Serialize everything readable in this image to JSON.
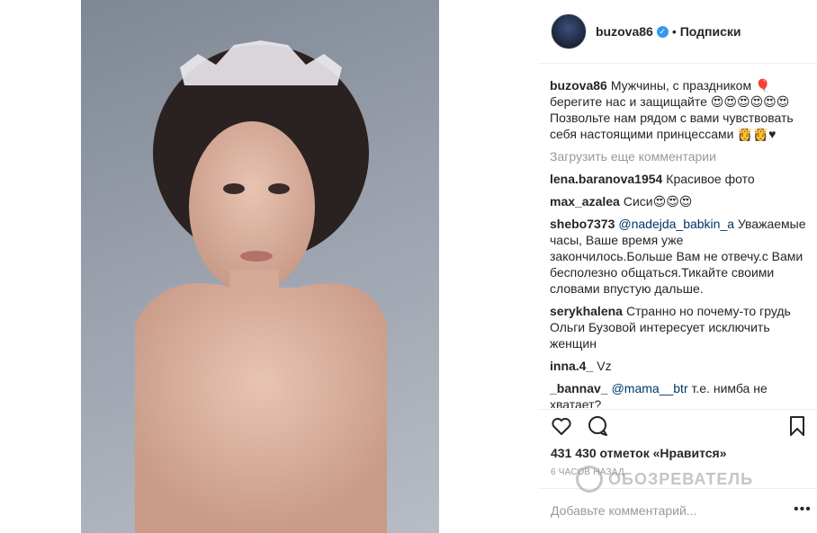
{
  "post": {
    "username": "buzova86",
    "follow_label": "Подписки",
    "caption": "Мужчины, с праздником 🎈 берегите нас и защищайте 😍😍😍😍😍😍 Позвольте нам рядом с вами чувствовать себя настоящими принцессами 👸👸♥",
    "load_more": "Загрузить еще комментарии",
    "likes": "431 430 отметок «Нравится»",
    "time": "6 часов назад",
    "add_comment_placeholder": "Добавьте комментарий...",
    "more_options": "•••"
  },
  "comments": [
    {
      "user": "lena.baranova1954",
      "text": "Красивое фото"
    },
    {
      "user": "max_azalea",
      "text": "Сиси😍😍😍"
    },
    {
      "user": "shebo7373",
      "mention": "@nadejda_babkin_a",
      "text": "Уважаемые часы, Ваше время уже закончилось.Больше Вам не отвечу.с Вами бесполезно общаться.Тикайте своими словами впустую дальше."
    },
    {
      "user": "serykhalena",
      "text": "Странно но почему-то грудь Ольги Бузовой интересует исключить женщин"
    },
    {
      "user": "inna.4_",
      "text": "Vz"
    },
    {
      "user": "_bannav_",
      "mention": "@mama__btr",
      "text": "т.е. нимба не хватает?"
    }
  ],
  "watermark": {
    "text": "ОБОЗРЕВАТЕЛЬ"
  },
  "icons": [
    "verified-badge-icon",
    "heart-icon",
    "comment-icon",
    "bookmark-icon",
    "more-icon"
  ],
  "colors": {
    "accent": "#3897f0",
    "mention": "#003569",
    "muted": "#999999"
  }
}
